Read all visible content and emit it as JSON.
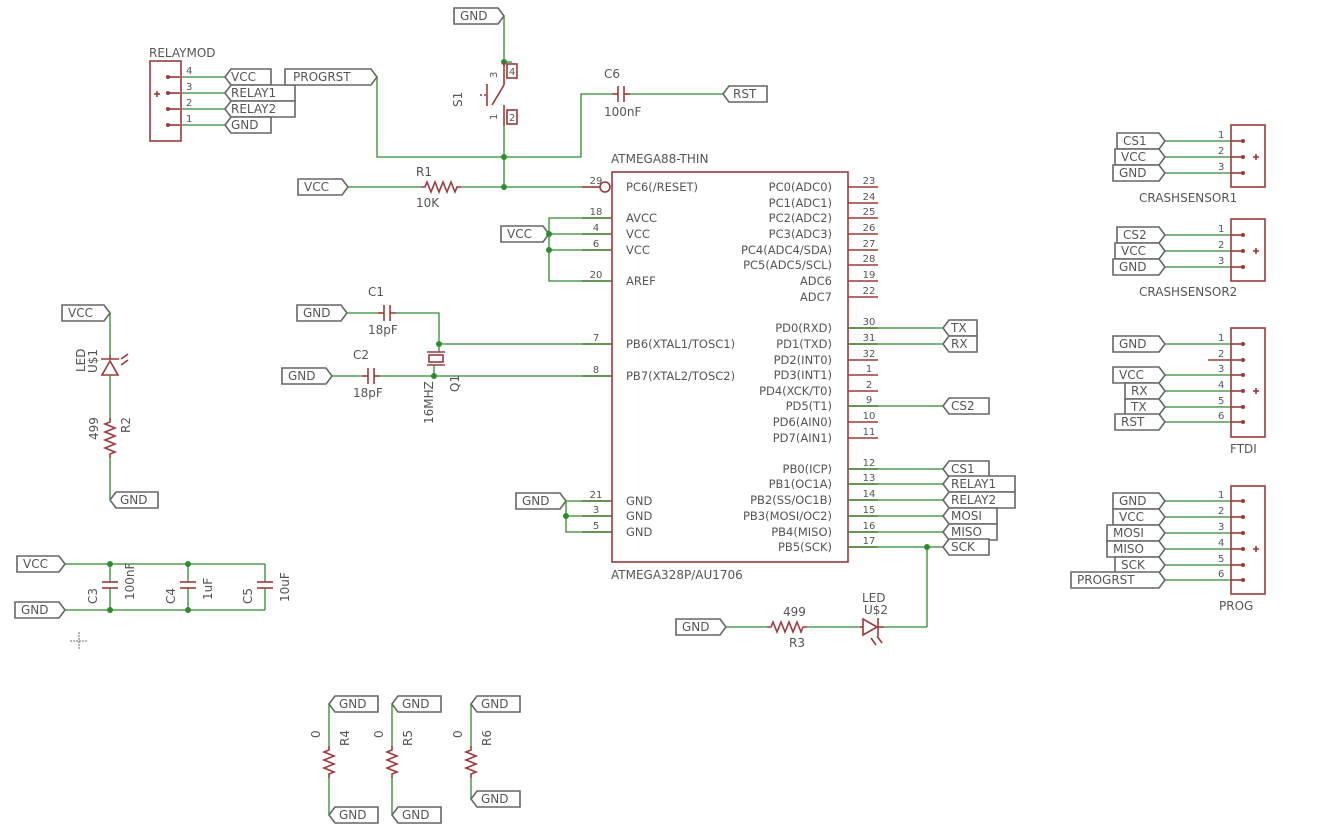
{
  "colors": {
    "wire": "#2e8b2e",
    "symbol": "#9b3a3a",
    "text": "#555555",
    "flag_outline": "#666666",
    "background": "#ffffff"
  },
  "mcu": {
    "name": "ATMEGA88-THIN",
    "value": "ATMEGA328P/AU1706",
    "left_pins": [
      {
        "num": "29",
        "name": "PC6(/RESET)"
      },
      {
        "num": "18",
        "name": "AVCC"
      },
      {
        "num": "4",
        "name": "VCC"
      },
      {
        "num": "6",
        "name": "VCC"
      },
      {
        "num": "20",
        "name": "AREF"
      },
      {
        "num": "7",
        "name": "PB6(XTAL1/TOSC1)"
      },
      {
        "num": "8",
        "name": "PB7(XTAL2/TOSC2)"
      },
      {
        "num": "21",
        "name": "GND"
      },
      {
        "num": "3",
        "name": "GND"
      },
      {
        "num": "5",
        "name": "GND"
      }
    ],
    "right_pins": [
      {
        "num": "23",
        "name": "PC0(ADC0)"
      },
      {
        "num": "24",
        "name": "PC1(ADC1)"
      },
      {
        "num": "25",
        "name": "PC2(ADC2)"
      },
      {
        "num": "26",
        "name": "PC3(ADC3)"
      },
      {
        "num": "27",
        "name": "PC4(ADC4/SDA)"
      },
      {
        "num": "28",
        "name": "PC5(ADC5/SCL)"
      },
      {
        "num": "19",
        "name": "ADC6"
      },
      {
        "num": "22",
        "name": "ADC7"
      },
      {
        "num": "30",
        "name": "PD0(RXD)"
      },
      {
        "num": "31",
        "name": "PD1(TXD)"
      },
      {
        "num": "32",
        "name": "PD2(INT0)"
      },
      {
        "num": "1",
        "name": "PD3(INT1)"
      },
      {
        "num": "2",
        "name": "PD4(XCK/T0)"
      },
      {
        "num": "9",
        "name": "PD5(T1)"
      },
      {
        "num": "10",
        "name": "PD6(AIN0)"
      },
      {
        "num": "11",
        "name": "PD7(AIN1)"
      },
      {
        "num": "12",
        "name": "PB0(ICP)"
      },
      {
        "num": "13",
        "name": "PB1(OC1A)"
      },
      {
        "num": "14",
        "name": "PB2(SS/OC1B)"
      },
      {
        "num": "15",
        "name": "PB3(MOSI/OC2)"
      },
      {
        "num": "16",
        "name": "PB4(MISO)"
      },
      {
        "num": "17",
        "name": "PB5(SCK)"
      }
    ]
  },
  "relaymod": {
    "name": "RELAYMOD",
    "pins": [
      "4",
      "3",
      "2",
      "1"
    ],
    "nets": [
      "VCC",
      "RELAY1",
      "RELAY2",
      "GND"
    ],
    "progrst": "PROGRST"
  },
  "switch": {
    "name": "S1",
    "pins": [
      "3",
      "4",
      "1",
      "2"
    ],
    "gnd": "GND"
  },
  "c6": {
    "name": "C6",
    "value": "100nF",
    "net": "RST"
  },
  "r1": {
    "name": "R1",
    "value": "10K",
    "net": "VCC"
  },
  "vcc_mcu": "VCC",
  "c1": {
    "name": "C1",
    "value": "18pF",
    "net": "GND"
  },
  "c2": {
    "name": "C2",
    "value": "18pF",
    "net": "GND"
  },
  "q1": {
    "name": "Q1",
    "value": "16MHZ"
  },
  "led1": {
    "name": "U$1",
    "value": "LED",
    "vcc": "VCC",
    "gnd": "GND"
  },
  "r2": {
    "name": "R2",
    "value": "499"
  },
  "caps": {
    "vcc": "VCC",
    "gnd": "GND",
    "c3": {
      "name": "C3",
      "value": "100nF"
    },
    "c4": {
      "name": "C4",
      "value": "1uF"
    },
    "c5": {
      "name": "C5",
      "value": "10uF"
    }
  },
  "gnd_mcu": "GND",
  "right_nets": {
    "tx": "TX",
    "rx": "RX",
    "cs2": "CS2",
    "cs1": "CS1",
    "relay1": "RELAY1",
    "relay2": "RELAY2",
    "mosi": "MOSI",
    "miso": "MISO",
    "sck": "SCK"
  },
  "led2": {
    "name": "U$2",
    "value": "LED",
    "gnd": "GND"
  },
  "r3": {
    "name": "R3",
    "value": "499"
  },
  "crash1": {
    "name": "CRASHSENSOR1",
    "pins": [
      "1",
      "2",
      "3"
    ],
    "nets": [
      "CS1",
      "VCC",
      "GND"
    ]
  },
  "crash2": {
    "name": "CRASHSENSOR2",
    "pins": [
      "1",
      "2",
      "3"
    ],
    "nets": [
      "CS2",
      "VCC",
      "GND"
    ]
  },
  "ftdi": {
    "name": "FTDI",
    "pins": [
      "1",
      "2",
      "3",
      "4",
      "5",
      "6"
    ],
    "nets": [
      "GND",
      "VCC",
      "RX",
      "TX",
      "RST"
    ]
  },
  "prog": {
    "name": "PROG",
    "pins": [
      "1",
      "2",
      "3",
      "4",
      "5",
      "6"
    ],
    "nets": [
      "GND",
      "VCC",
      "MOSI",
      "MISO",
      "SCK",
      "PROGRST"
    ]
  },
  "r4": {
    "name": "R4",
    "value": "0",
    "top": "GND",
    "bottom": "GND"
  },
  "r5": {
    "name": "R5",
    "value": "0",
    "top": "GND",
    "bottom": "GND"
  },
  "r6": {
    "name": "R6",
    "value": "0",
    "top": "GND",
    "bottom": "GND"
  }
}
